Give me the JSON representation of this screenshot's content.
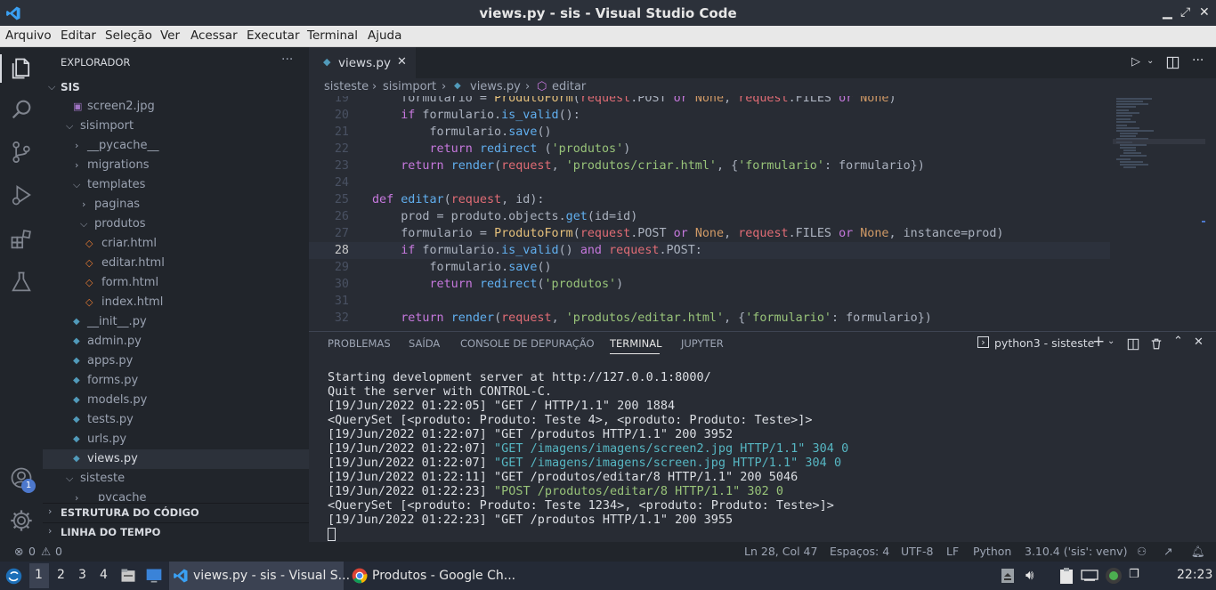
{
  "window": {
    "title": "views.py - sis - Visual Studio Code"
  },
  "menu": [
    "Arquivo",
    "Editar",
    "Seleção",
    "Ver",
    "Acessar",
    "Executar",
    "Terminal",
    "Ajuda"
  ],
  "activity": {
    "badge": "1",
    "icons": [
      "explorer-icon",
      "search-icon",
      "source-control-icon",
      "run-debug-icon",
      "extensions-icon",
      "testing-icon",
      "account-icon",
      "manage-gear-icon"
    ]
  },
  "sidebar": {
    "header": "EXPLORADOR",
    "more": "···",
    "root": "SIS",
    "items": [
      {
        "label": "screen2.jpg",
        "type": "img"
      },
      {
        "label": "sisimport",
        "type": "folder-open"
      },
      {
        "label": "__pycache__",
        "type": "folder"
      },
      {
        "label": "migrations",
        "type": "folder"
      },
      {
        "label": "templates",
        "type": "folder-open"
      },
      {
        "label": "paginas",
        "type": "folder"
      },
      {
        "label": "produtos",
        "type": "folder-open"
      },
      {
        "label": "criar.html",
        "type": "html"
      },
      {
        "label": "editar.html",
        "type": "html"
      },
      {
        "label": "form.html",
        "type": "html"
      },
      {
        "label": "index.html",
        "type": "html"
      },
      {
        "label": "__init__.py",
        "type": "py"
      },
      {
        "label": "admin.py",
        "type": "py"
      },
      {
        "label": "apps.py",
        "type": "py"
      },
      {
        "label": "forms.py",
        "type": "py"
      },
      {
        "label": "models.py",
        "type": "py"
      },
      {
        "label": "tests.py",
        "type": "py"
      },
      {
        "label": "urls.py",
        "type": "py"
      },
      {
        "label": "views.py",
        "type": "py"
      },
      {
        "label": "sisteste",
        "type": "folder-open"
      },
      {
        "label": "pycache",
        "type": "folder"
      }
    ],
    "sections": [
      "ESTRUTURA DO CÓDIGO",
      "LINHA DO TEMPO"
    ]
  },
  "editor": {
    "tab": "views.py",
    "breadcrumb": [
      "sisteste",
      "sisimport",
      "views.py",
      "editar"
    ],
    "lines": [
      {
        "n": "19",
        "text": "    formulario = ProdutoForm(request.POST or None, request.FILES or None)"
      },
      {
        "n": "20",
        "text": "    if formulario.is_valid():"
      },
      {
        "n": "21",
        "text": "        formulario.save()"
      },
      {
        "n": "22",
        "text": "        return redirect ('produtos')"
      },
      {
        "n": "23",
        "text": "    return render(request, 'produtos/criar.html', {'formulario': formulario})"
      },
      {
        "n": "24",
        "text": ""
      },
      {
        "n": "25",
        "text": "def editar(request, id):"
      },
      {
        "n": "26",
        "text": "    prod = produto.objects.get(id=id)"
      },
      {
        "n": "27",
        "text": "    formulario = ProdutoForm(request.POST or None, request.FILES or None, instance=prod)"
      },
      {
        "n": "28",
        "text": "    if formulario.is_valid() and request.POST:"
      },
      {
        "n": "29",
        "text": "        formulario.save()"
      },
      {
        "n": "30",
        "text": "        return redirect('produtos')"
      },
      {
        "n": "31",
        "text": ""
      },
      {
        "n": "32",
        "text": "    return render(request, 'produtos/editar.html', {'formulario': formulario})"
      }
    ]
  },
  "panel": {
    "tabs": [
      "PROBLEMAS",
      "SAÍDA",
      "CONSOLE DE DEPURAÇÃO",
      "TERMINAL",
      "JUPYTER"
    ],
    "active_tab": "TERMINAL",
    "terminal_name": "python3 - sisteste",
    "terminal_lines": [
      {
        "text": "Starting development server at http://127.0.0.1:8000/",
        "style": ""
      },
      {
        "text": "Quit the server with CONTROL-C.",
        "style": ""
      },
      {
        "pre": "[19/Jun/2022 01:22:05] ",
        "text": "\"GET / HTTP/1.1\" 200 1884",
        "style": ""
      },
      {
        "text": "<QuerySet [<produto: Produto: Teste 4>, <produto: Produto: Teste>]>",
        "style": ""
      },
      {
        "pre": "[19/Jun/2022 01:22:07] ",
        "text": "\"GET /produtos HTTP/1.1\" 200 3952",
        "style": ""
      },
      {
        "pre": "[19/Jun/2022 01:22:07] ",
        "text": "\"GET /imagens/imagens/screen2.jpg HTTP/1.1\" 304 0",
        "style": "cyan"
      },
      {
        "pre": "[19/Jun/2022 01:22:07] ",
        "text": "\"GET /imagens/imagens/screen.jpg HTTP/1.1\" 304 0",
        "style": "cyan"
      },
      {
        "pre": "[19/Jun/2022 01:22:11] ",
        "text": "\"GET /produtos/editar/8 HTTP/1.1\" 200 5046",
        "style": ""
      },
      {
        "pre": "[19/Jun/2022 01:22:23] ",
        "text": "\"POST /produtos/editar/8 HTTP/1.1\" 302 0",
        "style": "green"
      },
      {
        "text": "<QuerySet [<produto: Produto: Teste 1234>, <produto: Produto: Teste>]>",
        "style": ""
      },
      {
        "pre": "[19/Jun/2022 01:22:23] ",
        "text": "\"GET /produtos HTTP/1.1\" 200 3955",
        "style": ""
      }
    ]
  },
  "status": {
    "errors": "0",
    "warnings": "0",
    "position": "Ln 28, Col 47",
    "spaces": "Espaços: 4",
    "encoding": "UTF-8",
    "eol": "LF",
    "language": "Python",
    "interpreter": "3.10.4 ('sis': venv)"
  },
  "taskbar": {
    "workspaces": [
      "1",
      "2",
      "3",
      "4"
    ],
    "tasks": [
      "views.py - sis - Visual S...",
      "Produtos - Google Ch..."
    ],
    "clock": "22:23"
  },
  "colors": {
    "accent": "#528bff",
    "background": "#282c34",
    "sidebar": "#21252b"
  }
}
